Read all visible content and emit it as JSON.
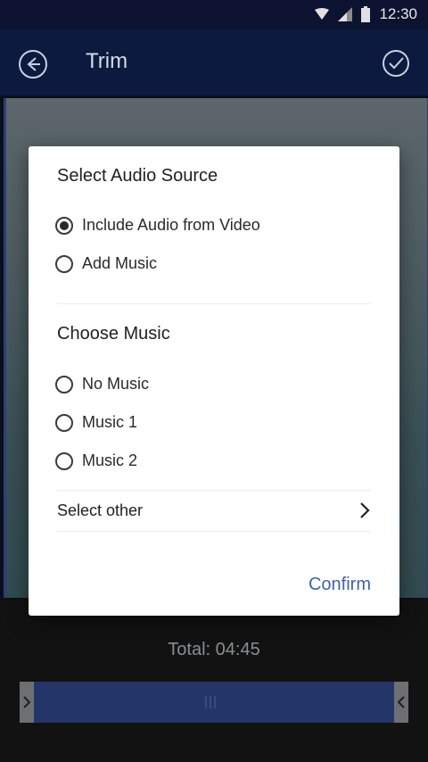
{
  "status_bar": {
    "time": "12:30"
  },
  "app_bar": {
    "title": "Trim"
  },
  "dialog": {
    "audio_source": {
      "title": "Select Audio Source",
      "options": [
        {
          "label": "Include Audio from Video",
          "checked": true
        },
        {
          "label": "Add Music",
          "checked": false
        }
      ]
    },
    "music": {
      "title": "Choose Music",
      "options": [
        {
          "label": "No Music",
          "checked": false
        },
        {
          "label": "Music 1",
          "checked": false
        },
        {
          "label": "Music 2",
          "checked": false
        }
      ],
      "select_other": "Select other"
    },
    "confirm_label": "Confirm"
  },
  "footer": {
    "total": "Total: 04:45"
  },
  "colors": {
    "accent": "#3f63a8",
    "app_bar": "#0d1a3f",
    "timeline": "#243568"
  }
}
